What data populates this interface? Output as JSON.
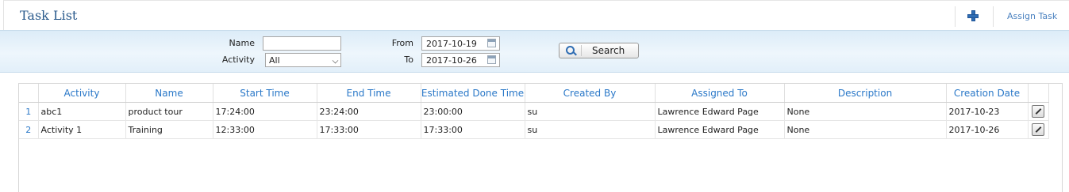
{
  "header": {
    "title": "Task List",
    "add_icon": "plus-icon",
    "assign_label": "Assign Task"
  },
  "filter": {
    "name_label": "Name",
    "name_value": "",
    "activity_label": "Activity",
    "activity_selected": "All",
    "from_label": "From",
    "from_value": "2017-10-19",
    "to_label": "To",
    "to_value": "2017-10-26",
    "search_label": "Search"
  },
  "table": {
    "columns": [
      "",
      "Activity",
      "Name",
      "Start Time",
      "End Time",
      "Estimated Done Time",
      "Created By",
      "Assigned To",
      "Description",
      "Creation Date",
      ""
    ],
    "rows": [
      {
        "num": "1",
        "activity": "abc1",
        "name": "product tour",
        "start": "17:24:00",
        "end": "23:24:00",
        "est": "23:00:00",
        "created_by": "su",
        "assigned_to": "Lawrence Edward Page",
        "description": "None",
        "creation_date": "2017-10-23"
      },
      {
        "num": "2",
        "activity": "Activity 1",
        "name": "Training",
        "start": "12:33:00",
        "end": "17:33:00",
        "est": "17:33:00",
        "created_by": "su",
        "assigned_to": "Lawrence Edward Page",
        "description": "None",
        "creation_date": "2017-10-26"
      }
    ]
  },
  "colors": {
    "title": "#2a5a8c",
    "link": "#2a78c8",
    "filter_bg": "#e2eff9"
  }
}
